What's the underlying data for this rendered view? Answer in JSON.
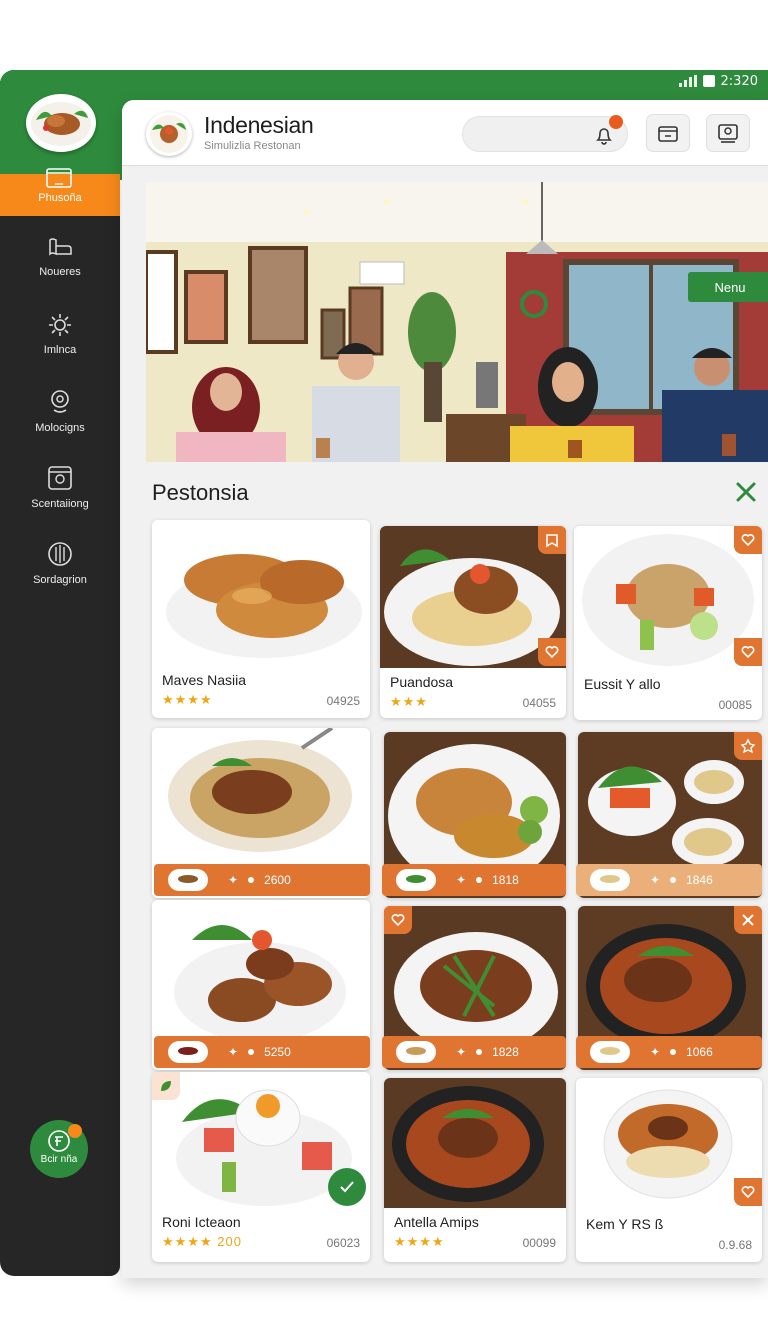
{
  "status_bar": {
    "time": "2:320"
  },
  "sidebar": {
    "active": {
      "label": "Phusoña"
    },
    "items": [
      {
        "label": "Noueres",
        "icon": "menu-book-icon"
      },
      {
        "label": "Imlnca",
        "icon": "settings-gear-icon"
      },
      {
        "label": "Molocigns",
        "icon": "location-pin-icon"
      },
      {
        "label": "Scentaiiong",
        "icon": "reservation-icon"
      },
      {
        "label": "Sordagrion",
        "icon": "globe-icon"
      }
    ],
    "cart": {
      "label": "Bcir nña",
      "badge": ""
    }
  },
  "header": {
    "title": "Indenesian",
    "subtitle": "Simulizlia Restonan"
  },
  "hero": {
    "button_label": "Nenu"
  },
  "section": {
    "title": "Pestonsia"
  },
  "menu_items": [
    {
      "name": "Maves Nasiia",
      "rating": "★★★★",
      "number": "04925"
    },
    {
      "name": "Puandosa",
      "rating": "★★★",
      "number": "04055"
    },
    {
      "name": "Eussit Y allo",
      "rating": "",
      "number": "00085"
    }
  ],
  "price_bars": [
    {
      "price": "2600"
    },
    {
      "price": "1818"
    },
    {
      "price": "1846"
    },
    {
      "price": "5250"
    },
    {
      "price": "1828"
    },
    {
      "price": "1066"
    }
  ],
  "bottom_items": [
    {
      "name": "Roni Icteaon",
      "rating": "★★★★",
      "extra": "200",
      "number": "06023"
    },
    {
      "name": "Antella Amips",
      "rating": "★★★★",
      "number": "00099"
    },
    {
      "name": "Kem Y RS ß",
      "rating": "",
      "number": "0.9.68"
    }
  ],
  "colors": {
    "brand_green": "#2e8b3d",
    "accent_orange": "#f7891b",
    "bar_orange": "#e07431",
    "sidebar_dark": "#262626"
  }
}
